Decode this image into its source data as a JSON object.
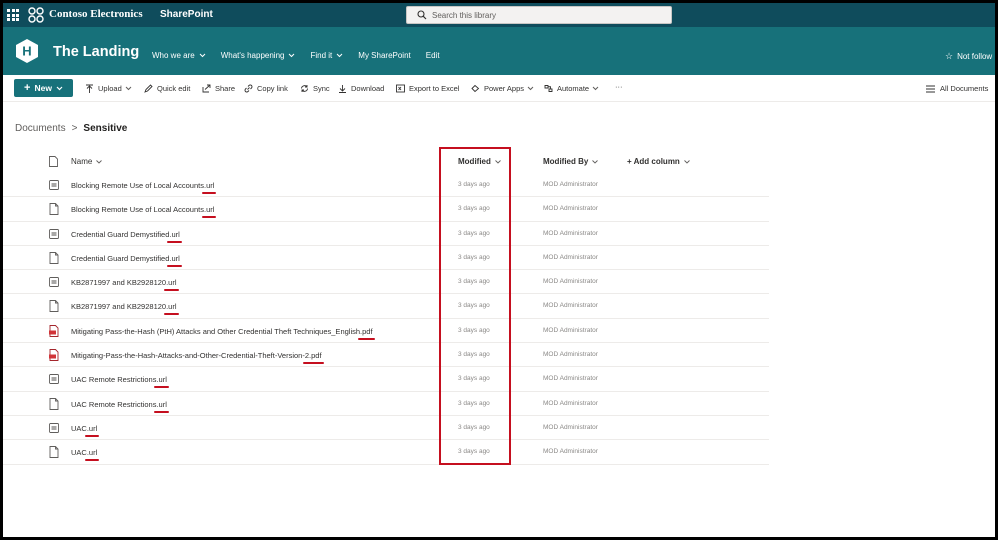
{
  "suitebar": {
    "brand": "Contoso Electronics",
    "app": "SharePoint",
    "search_placeholder": "Search this library"
  },
  "site": {
    "logo_letter": "H",
    "title": "The Landing",
    "nav": [
      {
        "label": "Who we are",
        "dropdown": true
      },
      {
        "label": "What's happening",
        "dropdown": true
      },
      {
        "label": "Find it",
        "dropdown": true
      },
      {
        "label": "My SharePoint",
        "dropdown": false
      },
      {
        "label": "Edit",
        "dropdown": false
      }
    ],
    "follow_label": "Not follow"
  },
  "commandbar": {
    "new_label": "New",
    "commands": [
      {
        "label": "Upload",
        "icon": "upload-icon",
        "dropdown": true
      },
      {
        "label": "Quick edit",
        "icon": "edit-icon",
        "dropdown": false
      },
      {
        "label": "Share",
        "icon": "share-icon",
        "dropdown": false
      },
      {
        "label": "Copy link",
        "icon": "link-icon",
        "dropdown": false
      },
      {
        "label": "Sync",
        "icon": "sync-icon",
        "dropdown": false
      },
      {
        "label": "Download",
        "icon": "download-icon",
        "dropdown": false
      },
      {
        "label": "Export to Excel",
        "icon": "excel-icon",
        "dropdown": false
      },
      {
        "label": "Power Apps",
        "icon": "powerapps-icon",
        "dropdown": true
      },
      {
        "label": "Automate",
        "icon": "automate-icon",
        "dropdown": true
      }
    ],
    "more_label": "···",
    "view_label": "All Documents"
  },
  "breadcrumb": {
    "root": "Documents",
    "separator": ">",
    "current": "Sensitive"
  },
  "list": {
    "columns": {
      "name": "Name",
      "modified": "Modified",
      "modified_by": "Modified By",
      "add_column": "+ Add column"
    },
    "rows": [
      {
        "base": "Blocking Remote Use of Local Accounts",
        "ext": ".url",
        "icon": "link-file-icon",
        "modified": "3 days ago",
        "modified_by": "MOD Administrator"
      },
      {
        "base": "Blocking Remote Use of Local Accounts",
        "ext": ".url",
        "icon": "document-icon",
        "modified": "3 days ago",
        "modified_by": "MOD Administrator"
      },
      {
        "base": "Credential Guard Demystified",
        "ext": ".url",
        "icon": "link-file-icon",
        "modified": "3 days ago",
        "modified_by": "MOD Administrator"
      },
      {
        "base": "Credential Guard Demystified",
        "ext": ".url",
        "icon": "document-icon",
        "modified": "3 days ago",
        "modified_by": "MOD Administrator"
      },
      {
        "base": "KB2871997 and KB2928120",
        "ext": ".url",
        "icon": "link-file-icon",
        "modified": "3 days ago",
        "modified_by": "MOD Administrator"
      },
      {
        "base": "KB2871997 and KB2928120",
        "ext": ".url",
        "icon": "document-icon",
        "modified": "3 days ago",
        "modified_by": "MOD Administrator"
      },
      {
        "base": "Mitigating Pass-the-Hash (PtH) Attacks and Other Credential Theft Techniques_English",
        "ext": ".pdf",
        "icon": "pdf-icon",
        "modified": "3 days ago",
        "modified_by": "MOD Administrator"
      },
      {
        "base": "Mitigating-Pass-the-Hash-Attacks-and-Other-Credential-Theft-Version-",
        "ext": "2.pdf",
        "icon": "pdf-icon",
        "modified": "3 days ago",
        "modified_by": "MOD Administrator"
      },
      {
        "base": "UAC Remote Restrictions",
        "ext": ".url",
        "icon": "link-file-icon",
        "modified": "3 days ago",
        "modified_by": "MOD Administrator"
      },
      {
        "base": "UAC Remote Restrictions",
        "ext": ".url",
        "icon": "document-icon",
        "modified": "3 days ago",
        "modified_by": "MOD Administrator"
      },
      {
        "base": "UAC",
        "ext": ".url",
        "icon": "link-file-icon",
        "modified": "3 days ago",
        "modified_by": "MOD Administrator"
      },
      {
        "base": "UAC",
        "ext": ".url",
        "icon": "document-icon",
        "modified": "3 days ago",
        "modified_by": "MOD Administrator"
      }
    ]
  },
  "colors": {
    "suitebar": "#0f4c5c",
    "site_header": "#17717a",
    "accent_button": "#17717a",
    "highlight": "#c50f1f"
  }
}
